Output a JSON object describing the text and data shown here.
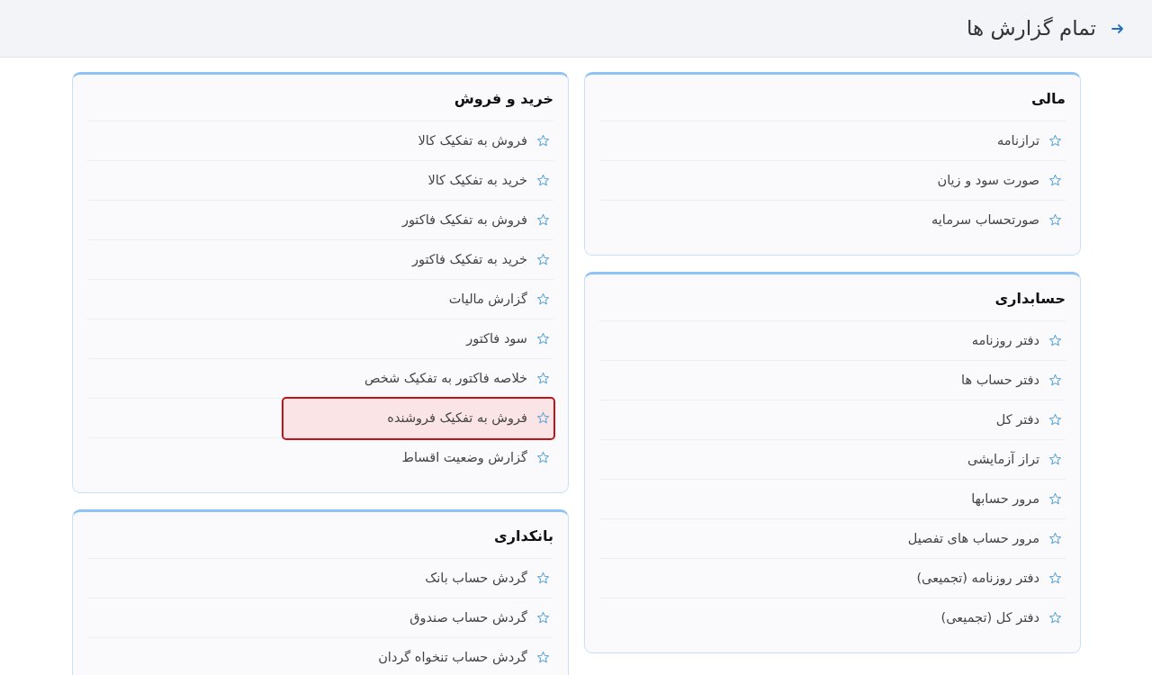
{
  "header": {
    "title": "تمام گزارش ها"
  },
  "columns": [
    [
      {
        "title": "مالی",
        "items": [
          {
            "label": "ترازنامه",
            "selected": false
          },
          {
            "label": "صورت سود و زیان",
            "selected": false
          },
          {
            "label": "صورتحساب سرمایه",
            "selected": false
          }
        ]
      },
      {
        "title": "حسابداری",
        "items": [
          {
            "label": "دفتر روزنامه",
            "selected": false
          },
          {
            "label": "دفتر حساب ها",
            "selected": false
          },
          {
            "label": "دفتر کل",
            "selected": false
          },
          {
            "label": "تراز آزمایشی",
            "selected": false
          },
          {
            "label": "مرور حسابها",
            "selected": false
          },
          {
            "label": "مرور حساب های تفصیل",
            "selected": false
          },
          {
            "label": "دفتر روزنامه (تجمیعی)",
            "selected": false
          },
          {
            "label": "دفتر کل (تجمیعی)",
            "selected": false
          }
        ]
      }
    ],
    [
      {
        "title": "خرید و فروش",
        "items": [
          {
            "label": "فروش به تفکیک کالا",
            "selected": false
          },
          {
            "label": "خرید به تفکیک کالا",
            "selected": false
          },
          {
            "label": "فروش به تفکیک فاکتور",
            "selected": false
          },
          {
            "label": "خرید به تفکیک فاکتور",
            "selected": false
          },
          {
            "label": "گزارش مالیات",
            "selected": false
          },
          {
            "label": "سود فاکتور",
            "selected": false
          },
          {
            "label": "خلاصه فاکتور به تفکیک شخص",
            "selected": false
          },
          {
            "label": "فروش به تفکیک فروشنده",
            "selected": true
          },
          {
            "label": "گزارش وضعیت اقساط",
            "selected": false
          }
        ]
      },
      {
        "title": "بانکداری",
        "items": [
          {
            "label": "گردش حساب بانک",
            "selected": false
          },
          {
            "label": "گردش حساب صندوق",
            "selected": false
          },
          {
            "label": "گردش حساب تنخواه گردان",
            "selected": false
          }
        ]
      }
    ]
  ]
}
